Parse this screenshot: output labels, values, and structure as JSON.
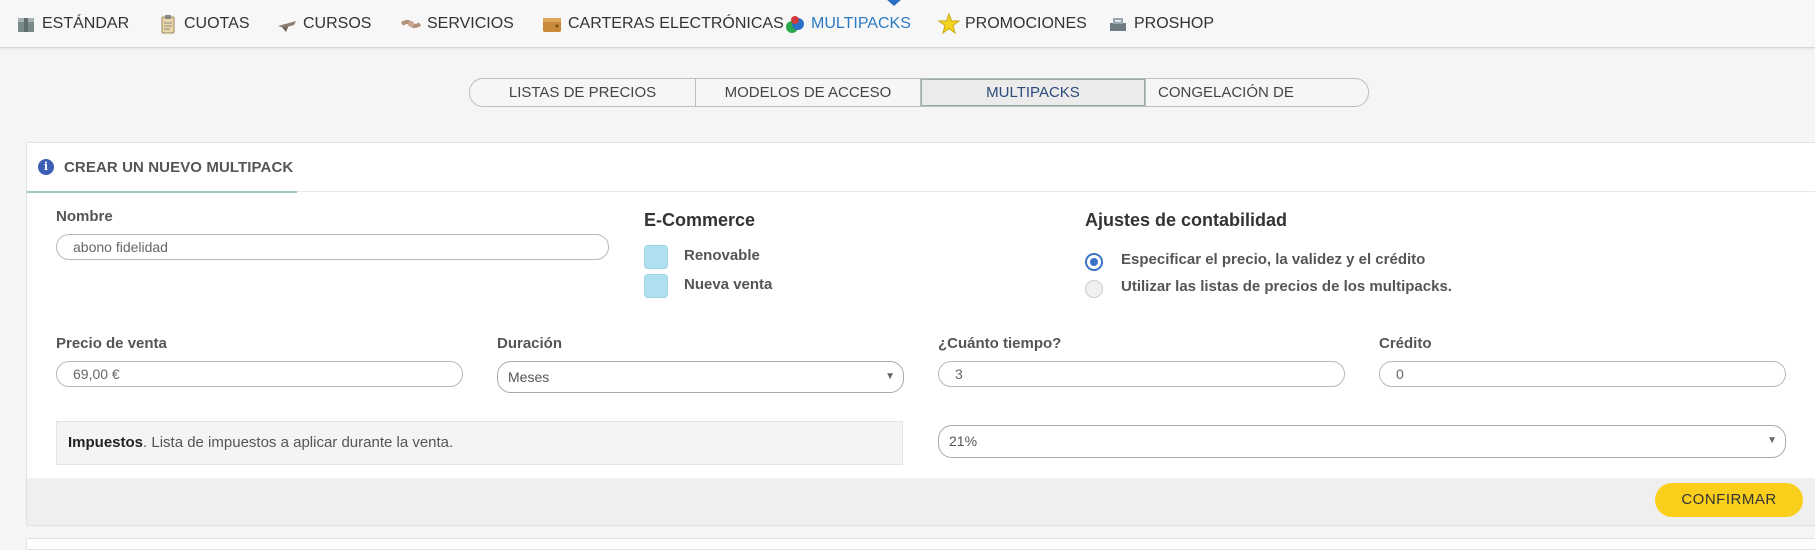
{
  "nav": {
    "items": [
      {
        "label": "ESTÁNDAR",
        "icon": "box-icon"
      },
      {
        "label": "CUOTAS",
        "icon": "clipboard-icon"
      },
      {
        "label": "CURSOS",
        "icon": "plane-icon"
      },
      {
        "label": "SERVICIOS",
        "icon": "handshake-icon"
      },
      {
        "label": "CARTERAS ELECTRÓNICAS",
        "icon": "wallet-icon"
      },
      {
        "label": "MULTIPACKS",
        "icon": "multipack-icon"
      },
      {
        "label": "PROMOCIONES",
        "icon": "star-icon"
      },
      {
        "label": "PROSHOP",
        "icon": "register-icon"
      }
    ],
    "active": "MULTIPACKS"
  },
  "subtabs": {
    "items": [
      {
        "label": "LISTAS DE PRECIOS"
      },
      {
        "label": "MODELOS DE ACCESO"
      },
      {
        "label": "MULTIPACKS"
      },
      {
        "label": "CONGELACIÓN DE MULTIPACKS"
      }
    ],
    "active": "MULTIPACKS"
  },
  "panel": {
    "title": "CREAR UN NUEVO MULTIPACK",
    "name": {
      "label": "Nombre",
      "value": "abono fidelidad"
    },
    "ecommerce": {
      "title": "E-Commerce",
      "options": [
        {
          "label": "Renovable",
          "checked": false
        },
        {
          "label": "Nueva venta",
          "checked": false
        }
      ]
    },
    "accounting": {
      "title": "Ajustes de contabilidad",
      "options": [
        {
          "label": "Especificar el precio, la validez y el crédito",
          "selected": true
        },
        {
          "label": "Utilizar las listas de precios de los multipacks.",
          "selected": false
        }
      ]
    },
    "price": {
      "label": "Precio de venta",
      "value": "69,00 €"
    },
    "duration": {
      "label": "Duración",
      "value": "Meses"
    },
    "how_long": {
      "label": "¿Cuánto tiempo?",
      "value": "3"
    },
    "credit": {
      "label": "Crédito",
      "value": "0"
    },
    "taxes": {
      "bold": "Impuestos",
      "text": ". Lista de impuestos a aplicar durante la venta.",
      "value": "21%"
    },
    "confirm_label": "CONFIRMAR"
  },
  "colors": {
    "accent": "#2a7ac6",
    "confirm": "#f9cf1c",
    "checkbox": "#aee0ef",
    "radio": "#3a74c5"
  }
}
